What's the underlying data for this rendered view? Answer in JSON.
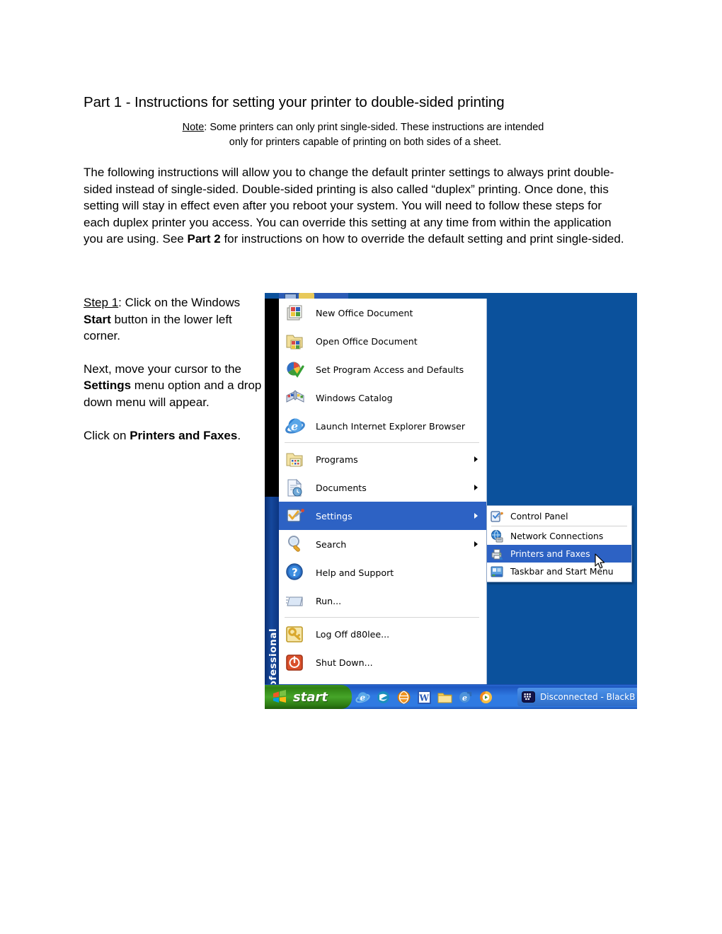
{
  "document": {
    "title": "Part 1 - Instructions for setting your printer to double-sided printing",
    "note": {
      "label": "Note",
      "line1": ":  Some printers can only print single-sided.  These instructions are intended",
      "line2": "only for printers capable of printing on both sides of a sheet."
    },
    "intro_paragraph": {
      "t1": "The following instructions will allow you to change the default printer settings to always print double-sided instead of single-sided.  Double-sided printing is also called “duplex” printing.  Once done, this setting will stay in effect even after you reboot your system.  You will need to follow these steps for each duplex printer you access.  You can override this setting at any time from within the application you are using.  See ",
      "bold1": "Part 2",
      "t2": " for instructions on how to override the default setting and print single-sided."
    },
    "step": {
      "p1_label": "Step 1",
      "p1_a": ":  Click on the Windows ",
      "p1_bold": "Start",
      "p1_b": " button in the lower left corner.",
      "p2": "Next, move your cursor to the ",
      "p2_bold": "Settings",
      "p2_b": " menu option and a drop down menu will appear.",
      "p3_a": "Click on ",
      "p3_bold": "Printers and Faxes",
      "p3_b": "."
    }
  },
  "screenshot": {
    "branding": "Windows XP Professional",
    "desktop_color": "#0b519c",
    "highlight_color": "#2d62c4",
    "start_menu": {
      "items": [
        {
          "label": "New Office Document",
          "icon": "new-office-document-icon",
          "submenu": false,
          "selected": false
        },
        {
          "label": "Open Office Document",
          "icon": "open-office-document-icon",
          "submenu": false,
          "selected": false
        },
        {
          "label": "Set Program Access and Defaults",
          "icon": "set-program-access-icon",
          "submenu": false,
          "selected": false
        },
        {
          "label": "Windows Catalog",
          "icon": "windows-catalog-icon",
          "submenu": false,
          "selected": false
        },
        {
          "label": "Launch Internet Explorer Browser",
          "icon": "internet-explorer-icon",
          "submenu": false,
          "selected": false
        },
        {
          "label": "Programs",
          "icon": "programs-folder-icon",
          "submenu": true,
          "selected": false
        },
        {
          "label": "Documents",
          "icon": "documents-icon",
          "submenu": true,
          "selected": false
        },
        {
          "label": "Settings",
          "icon": "settings-icon",
          "submenu": true,
          "selected": true
        },
        {
          "label": "Search",
          "icon": "search-magnifier-icon",
          "submenu": true,
          "selected": false
        },
        {
          "label": "Help and Support",
          "icon": "help-question-icon",
          "submenu": false,
          "selected": false
        },
        {
          "label": "Run...",
          "icon": "run-icon",
          "submenu": false,
          "selected": false
        },
        {
          "label": "Log Off d80lee...",
          "icon": "log-off-key-icon",
          "submenu": false,
          "selected": false
        },
        {
          "label": "Shut Down...",
          "icon": "shut-down-power-icon",
          "submenu": false,
          "selected": false
        }
      ]
    },
    "settings_submenu": {
      "items": [
        {
          "label": "Control Panel",
          "icon": "control-panel-icon",
          "selected": false
        },
        {
          "label": "Network Connections",
          "icon": "network-connections-icon",
          "selected": false
        },
        {
          "label": "Printers and Faxes",
          "icon": "printers-and-faxes-icon",
          "selected": true
        },
        {
          "label": "Taskbar and Start Menu",
          "icon": "taskbar-start-menu-icon",
          "selected": false
        }
      ]
    },
    "taskbar": {
      "start_label": "start",
      "quick_launch": [
        "internet-explorer-icon",
        "msn-messenger-icon",
        "orange-globe-icon",
        "microsoft-word-icon",
        "folder-icon",
        "show-desktop-icon",
        "media-player-icon"
      ],
      "tray_button": {
        "label": "Disconnected - BlackB",
        "icon": "blackberry-icon"
      }
    }
  }
}
